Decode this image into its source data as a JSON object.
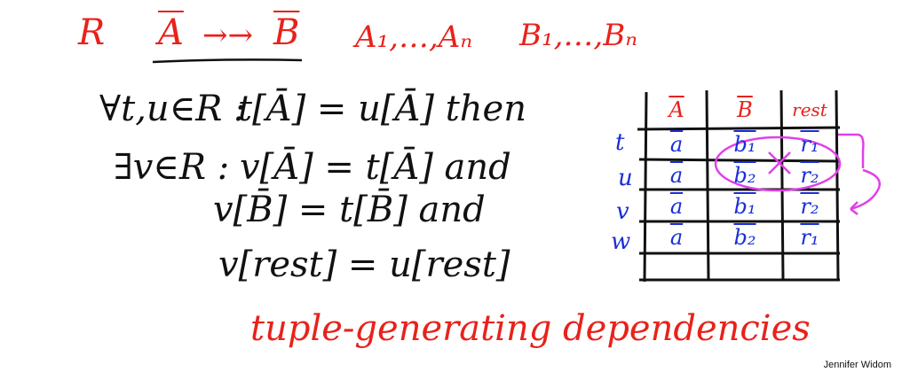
{
  "header": {
    "relation": "R",
    "lhs": "A",
    "arrow": "→→",
    "rhs": "B",
    "a_list": "A₁,…,Aₙ",
    "b_list": "B₁,…,Bₙ"
  },
  "rule": {
    "line1_quant": "∀t,u∈R :",
    "line1_body": "t[Ā] = u[Ā] then",
    "line2_quant": "∃v∈R :",
    "line2_body": "v[Ā] = t[Ā] and",
    "line3_body": "v[B̄] = t[B̄] and",
    "line4_body": "v[rest] = u[rest]"
  },
  "footer_title": "tuple-generating dependencies",
  "table": {
    "headers": [
      "A",
      "B",
      "rest"
    ],
    "rows": [
      {
        "label": "t",
        "cells": [
          "a",
          "b₁",
          "r₁"
        ]
      },
      {
        "label": "u",
        "cells": [
          "a",
          "b₂",
          "r₂"
        ]
      },
      {
        "label": "v",
        "cells": [
          "a",
          "b₁",
          "r₂"
        ]
      },
      {
        "label": "w",
        "cells": [
          "a",
          "b₂",
          "r₁"
        ]
      },
      {
        "label": "",
        "cells": [
          "",
          "",
          ""
        ]
      }
    ]
  },
  "colors": {
    "red": "#e8221b",
    "black": "#111111",
    "blue": "#1a2fd6",
    "magenta": "#e040e8"
  },
  "credit": "Jennifer Widom"
}
